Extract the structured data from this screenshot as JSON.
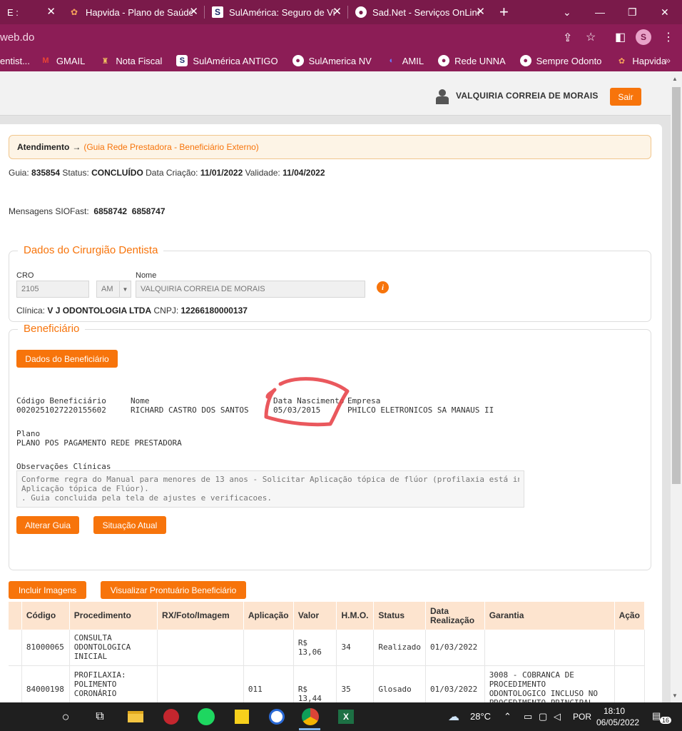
{
  "browser": {
    "tabs": [
      {
        "title": "E :",
        "favicon": "page-icon"
      },
      {
        "title": "Hapvida - Plano de Saúde",
        "favicon": "hapvida-flower-icon"
      },
      {
        "title": "SulAmérica: Seguro de Vi",
        "favicon": "sulamerica-icon"
      },
      {
        "title": "Sad.Net - Serviços OnLine",
        "favicon": "globe-icon"
      }
    ],
    "url": "web.do",
    "profile_initial": "S",
    "bookmarks": [
      {
        "label": "entist...",
        "icon": "none"
      },
      {
        "label": "GMAIL",
        "icon": "gmail-icon"
      },
      {
        "label": "Nota Fiscal",
        "icon": "crest-icon"
      },
      {
        "label": "SulAmérica ANTIGO",
        "icon": "sulamerica-icon"
      },
      {
        "label": "SulAmerica NV",
        "icon": "globe-icon"
      },
      {
        "label": "AMIL",
        "icon": "amil-icon"
      },
      {
        "label": "Rede UNNA",
        "icon": "globe-icon"
      },
      {
        "label": "Sempre Odonto",
        "icon": "globe-icon"
      },
      {
        "label": "Hapvida",
        "icon": "hapvida-flower-icon"
      }
    ]
  },
  "header": {
    "user_name": "VALQUIRIA CORREIA DE MORAIS",
    "logout_label": "Sair"
  },
  "breadcrumb": {
    "root": "Atendimento",
    "arrow": "→",
    "current": "(Guia Rede Prestadora - Beneficiário Externo)"
  },
  "guia": {
    "guia_label": "Guia:",
    "guia_value": "835854",
    "status_label": "Status:",
    "status_value": "CONCLUÍDO",
    "data_criacao_label": "Data Criação:",
    "data_criacao_value": "11/01/2022",
    "validade_label": "Validade:",
    "validade_value": "11/04/2022",
    "mensagens_label": "Mensagens SIOFast:",
    "mensagens_values": "6858742  6858747"
  },
  "dentista": {
    "section_title": "Dados do Cirurgião Dentista",
    "cro_label": "CRO",
    "cro_value": "2105",
    "uf_value": "AM",
    "nome_label": "Nome",
    "nome_value": "VALQUIRIA CORREIA DE MORAIS",
    "clinica_label": "Clínica:",
    "clinica_value": "V J ODONTOLOGIA LTDA",
    "cnpj_label": "CNPJ:",
    "cnpj_value": "12266180000137"
  },
  "beneficiario": {
    "section_title": "Beneficiário",
    "dados_button": "Dados do Beneficiário",
    "codigo_label": "Código Beneficiário",
    "codigo_value": "0020251027220155602",
    "nome_label": "Nome",
    "nome_value": "RICHARD CASTRO DOS SANTOS",
    "nascimento_label": "Data Nascimento",
    "nascimento_value": "05/03/2015",
    "empresa_label": "Empresa",
    "empresa_value": "PHILCO ELETRONICOS SA MANAUS II",
    "plano_label": "Plano",
    "plano_value": "PLANO POS PAGAMENTO REDE PRESTADORA",
    "obs_label": "Observações Clínicas",
    "obs_line1": "Conforme regra do Manual para menores de 13 anos - Solicitar Aplicação tópica de flúor (profilaxia está incluso no ato de",
    "obs_line2": "Aplicação tópica de Flúor).",
    "obs_line3": ". Guia concluida pela tela de ajustes e verificacoes.",
    "alterar_button": "Alterar Guia",
    "situacao_button": "Situação Atual"
  },
  "actions": {
    "incluir_imagens": "Incluir Imagens",
    "visualizar_prontuario": "Visualizar Prontuário Beneficiário"
  },
  "procedimentos": {
    "headers": [
      "Código",
      "Procedimento",
      "RX/Foto/Imagem",
      "Aplicação",
      "Valor",
      "H.M.O.",
      "Status",
      "Data Realização",
      "Garantia",
      "Ação"
    ],
    "header_data_line1": "Data",
    "header_data_line2": "Realização",
    "rows": [
      {
        "codigo": "81000065",
        "proc_l1": "CONSULTA",
        "proc_l2": "ODONTOLOGICA",
        "proc_l3": "INICIAL",
        "rx": "",
        "aplicacao": "",
        "valor": "R$ 13,06",
        "hmo": "34",
        "status": "Realizado",
        "data": "01/03/2022",
        "garantia": ""
      },
      {
        "codigo": "84000198",
        "proc_l1": "PROFILAXIA:",
        "proc_l2": "POLIMENTO",
        "proc_l3": "CORONÁRIO",
        "rx": "",
        "aplicacao": "011",
        "valor": "R$ 13,44",
        "hmo": "35",
        "status": "Glosado",
        "data": "01/03/2022",
        "gar_l1": "3008 - COBRANCA DE",
        "gar_l2": "PROCEDIMENTO",
        "gar_l3": "ODONTOLOGICO INCLUSO NO",
        "gar_l4": "PROCEDIMENTO PRINCIPAL"
      }
    ]
  },
  "taskbar": {
    "weather": "28°C",
    "language": "POR",
    "time": "18:10",
    "date": "06/05/2022",
    "notification_count": "16"
  },
  "colors": {
    "brand_orange": "#f7740b",
    "browser_frame": "#7a1a4a",
    "annotation_red": "#e8464b"
  }
}
